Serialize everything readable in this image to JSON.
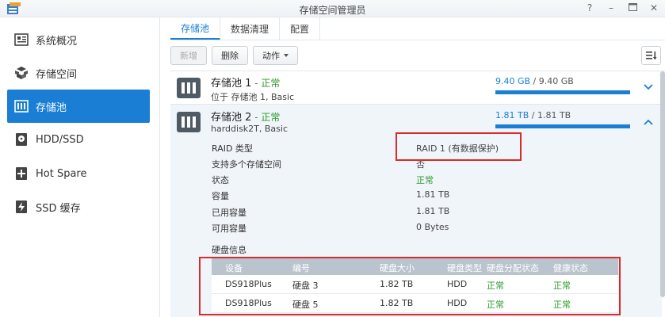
{
  "window": {
    "title": "存储空间管理员",
    "help": "?",
    "minimize": "–",
    "maximize": "▫",
    "close": "✕"
  },
  "sidebar": {
    "items": [
      {
        "label": "系统概况",
        "icon": "overview-icon",
        "active": false
      },
      {
        "label": "存储空间",
        "icon": "storage-icon",
        "active": false
      },
      {
        "label": "存储池",
        "icon": "storage-pool-icon",
        "active": true
      },
      {
        "label": "HDD/SSD",
        "icon": "hdd-icon",
        "active": false
      },
      {
        "label": "Hot Spare",
        "icon": "hot-spare-icon",
        "active": false
      },
      {
        "label": "SSD 缓存",
        "icon": "ssd-cache-icon",
        "active": false
      }
    ]
  },
  "tabs": [
    {
      "label": "存储池",
      "active": true
    },
    {
      "label": "数据清理",
      "active": false
    },
    {
      "label": "配置",
      "active": false
    }
  ],
  "toolbar": {
    "new_label": "新增",
    "delete_label": "删除",
    "action_label": "动作"
  },
  "pools": [
    {
      "name": "存储池 1",
      "separator": " - ",
      "status": "正常",
      "subtitle": "位于 存储池 1, Basic",
      "used": "9.40 GB",
      "slash": " / ",
      "total": "9.40 GB",
      "usage_fraction": 1.0
    },
    {
      "name": "存储池 2",
      "separator": " - ",
      "status": "正常",
      "subtitle": "harddisk2T, Basic",
      "used": "1.81 TB",
      "slash": " / ",
      "total": "1.81 TB",
      "usage_fraction": 1.0
    }
  ],
  "properties": [
    {
      "label": "RAID 类型",
      "value": "RAID 1 (有数据保护)"
    },
    {
      "label": "支持多个存储空间",
      "value": "否"
    },
    {
      "label": "状态",
      "value": "正常"
    },
    {
      "label": "容量",
      "value": "1.81 TB"
    },
    {
      "label": "已用容量",
      "value": "1.81 TB"
    },
    {
      "label": "可用容量",
      "value": "0 Bytes"
    }
  ],
  "disk_section_title": "硬盘信息",
  "disk_table": {
    "headers": [
      "设备",
      "编号",
      "硬盘大小",
      "硬盘类型",
      "硬盘分配状态",
      "健康状态"
    ],
    "rows": [
      [
        "DS918Plus",
        "硬盘 3",
        "1.82 TB",
        "HDD",
        "正常",
        "正常"
      ],
      [
        "DS918Plus",
        "硬盘 5",
        "1.82 TB",
        "HDD",
        "正常",
        "正常"
      ]
    ]
  },
  "colors": {
    "accent": "#1a7fd4",
    "ok_green": "#2d9b2d",
    "highlight_red": "#d92b2b"
  }
}
